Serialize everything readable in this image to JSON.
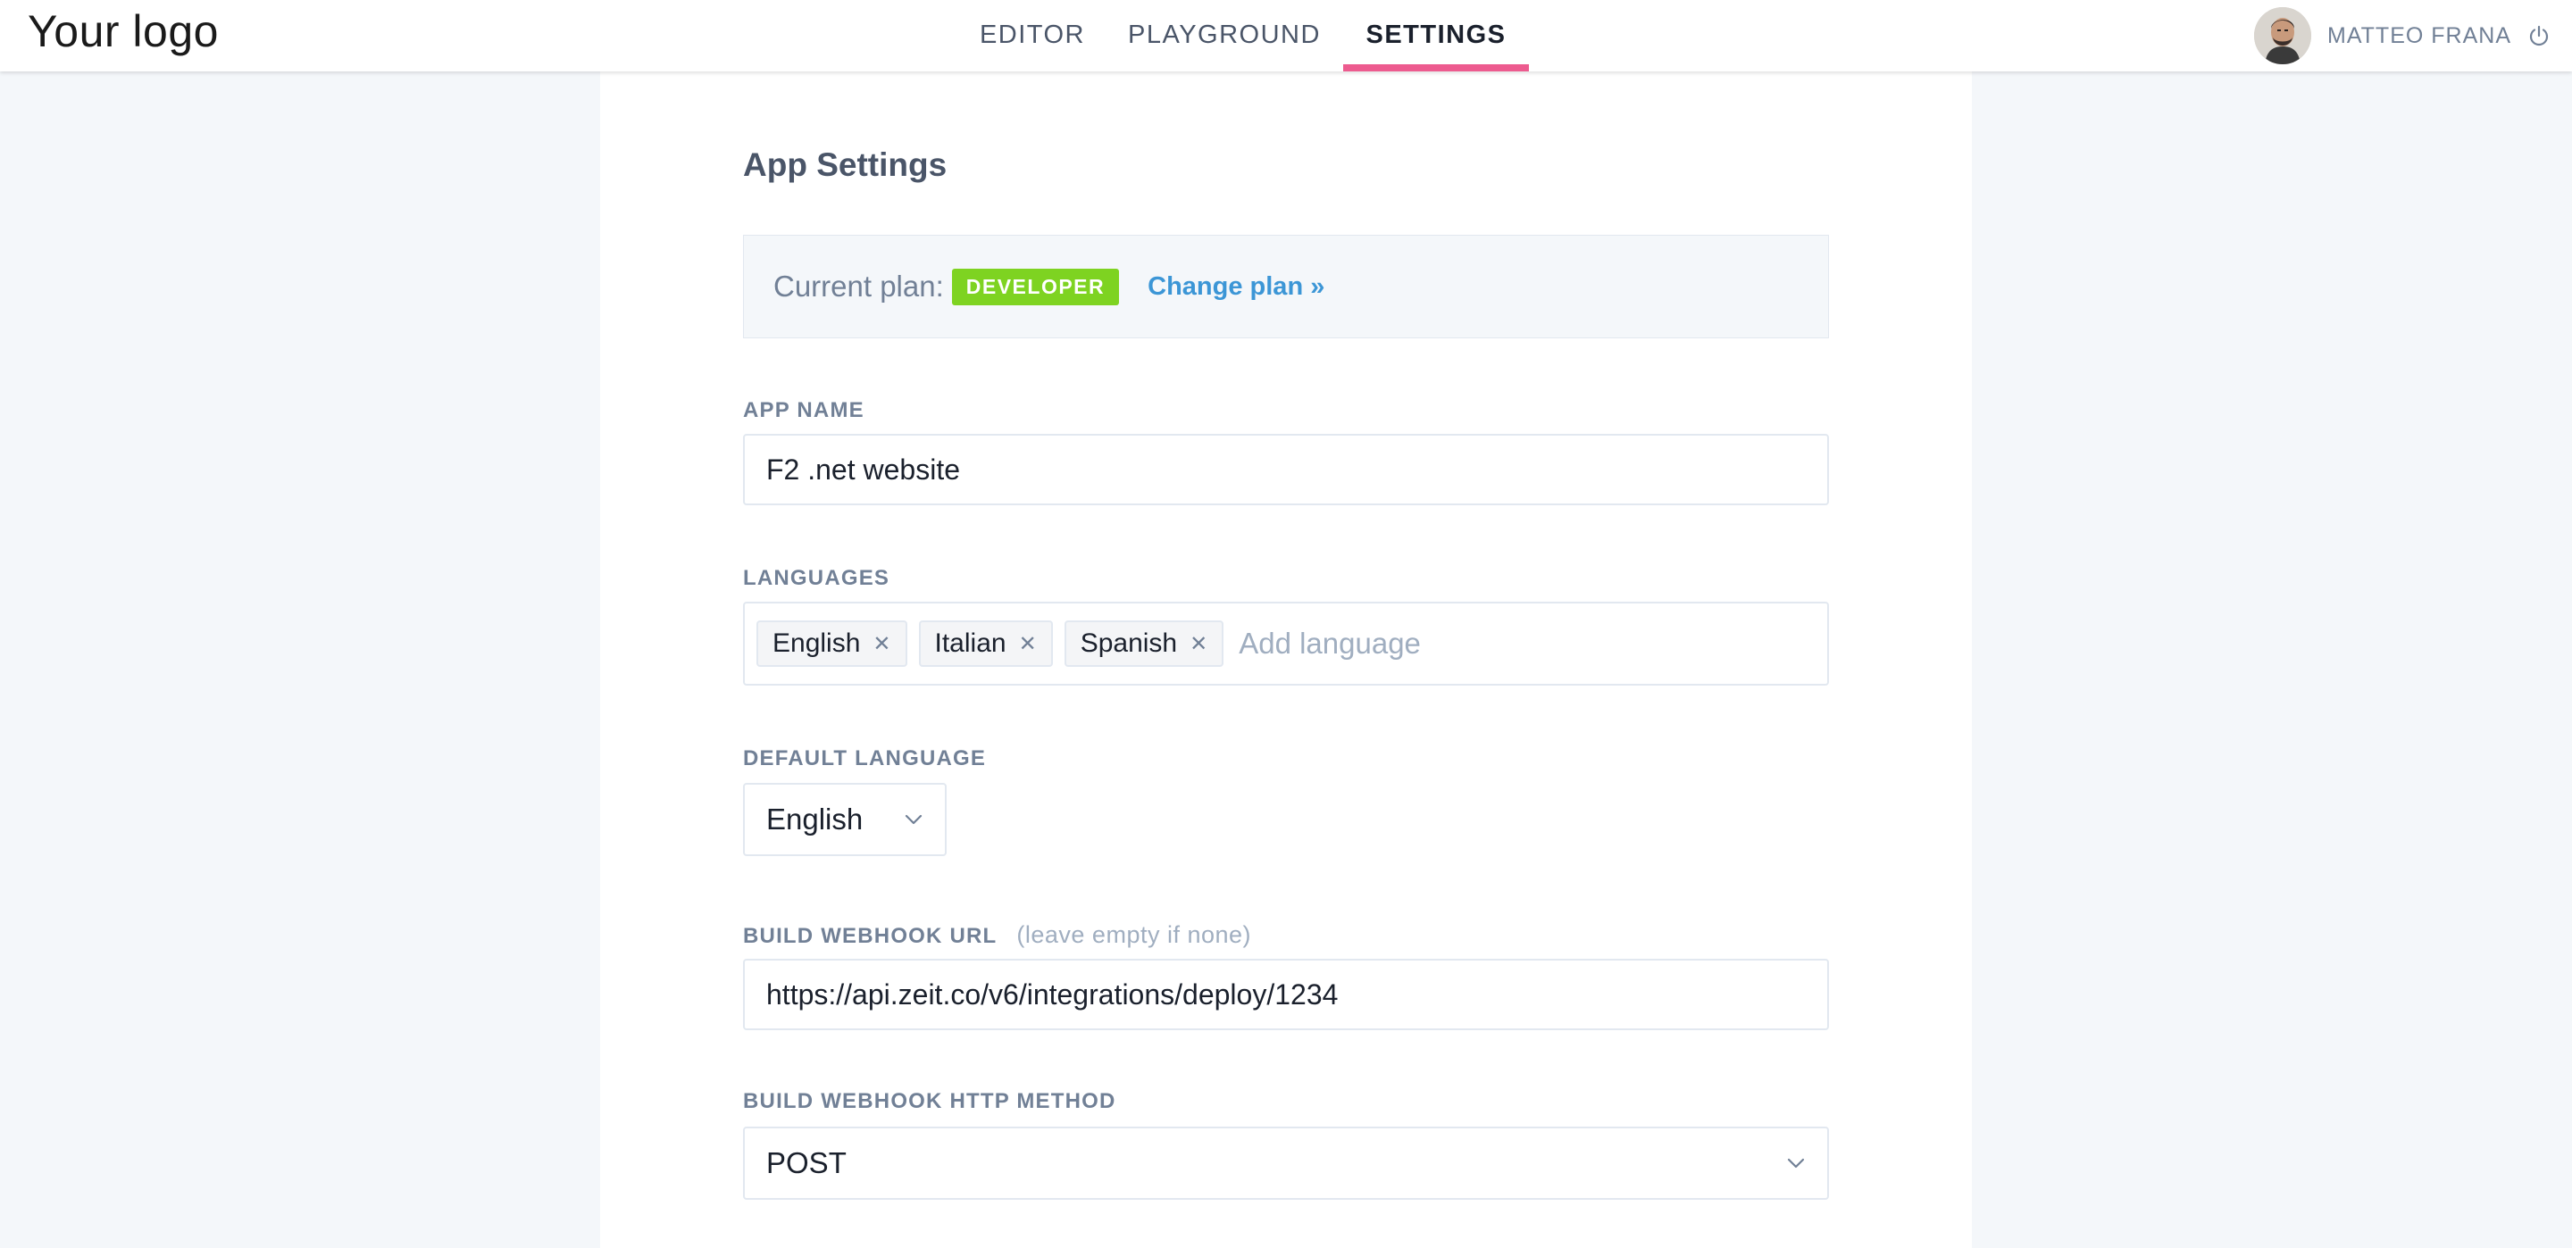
{
  "header": {
    "logo": "Your logo",
    "tabs": [
      {
        "label": "EDITOR",
        "active": false
      },
      {
        "label": "PLAYGROUND",
        "active": false
      },
      {
        "label": "SETTINGS",
        "active": true
      }
    ],
    "user_name": "MATTEO FRANA",
    "accent_color": "#ed5b8f"
  },
  "page": {
    "title": "App Settings",
    "plan": {
      "label": "Current plan:",
      "badge": "DEVELOPER",
      "badge_color": "#7ed321",
      "change_link": "Change plan »"
    },
    "app_name": {
      "label": "APP NAME",
      "value": "F2 .net website"
    },
    "languages": {
      "label": "LANGUAGES",
      "tags": [
        "English",
        "Italian",
        "Spanish"
      ],
      "placeholder": "Add language"
    },
    "default_language": {
      "label": "DEFAULT LANGUAGE",
      "value": "English"
    },
    "webhook_url": {
      "label": "BUILD WEBHOOK URL",
      "hint": "(leave empty if none)",
      "value": "https://api.zeit.co/v6/integrations/deploy/1234"
    },
    "webhook_method": {
      "label": "BUILD WEBHOOK HTTP METHOD",
      "value": "POST"
    }
  }
}
